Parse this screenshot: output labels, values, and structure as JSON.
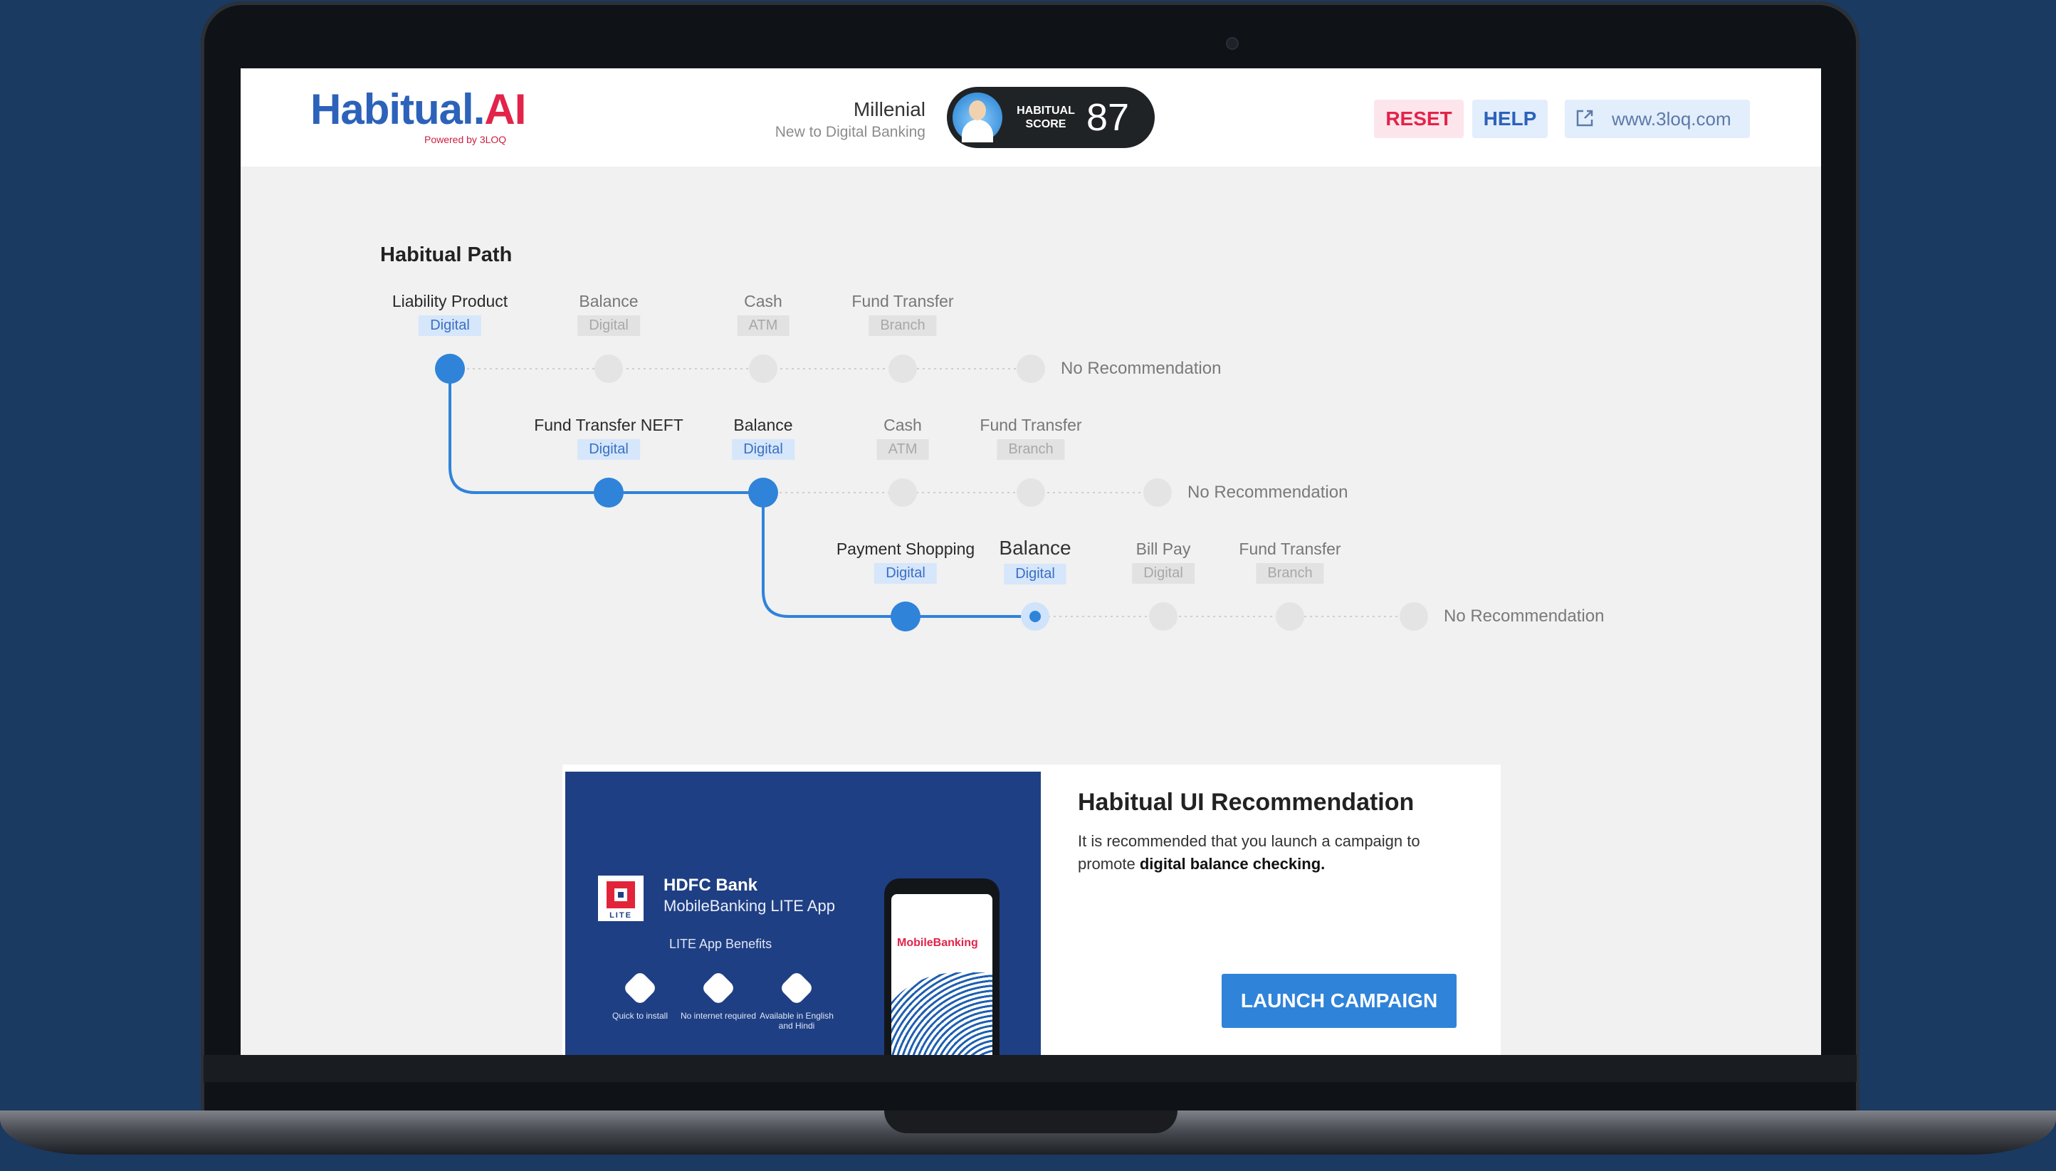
{
  "header": {
    "logo_main": "Habitual.",
    "logo_ai": "AI",
    "logo_powered": "Powered by 3LOQ",
    "persona_name": "Millenial",
    "persona_sub": "New to Digital Banking",
    "score_label_line1": "HABITUAL",
    "score_label_line2": "SCORE",
    "score_value": "87",
    "reset_label": "RESET",
    "help_label": "HELP",
    "site_link": "www.3loq.com"
  },
  "path": {
    "title": "Habitual Path",
    "rows": [
      {
        "steps": [
          {
            "name": "Liability Product",
            "tag": "Digital",
            "active": true
          },
          {
            "name": "Balance",
            "tag": "Digital",
            "active": false
          },
          {
            "name": "Cash",
            "tag": "ATM",
            "active": false
          },
          {
            "name": "Fund Transfer",
            "tag": "Branch",
            "active": false
          }
        ],
        "end_label": "No Recommendation"
      },
      {
        "steps": [
          {
            "name": "Fund Transfer NEFT",
            "tag": "Digital",
            "active": true
          },
          {
            "name": "Balance",
            "tag": "Digital",
            "active": true
          },
          {
            "name": "Cash",
            "tag": "ATM",
            "active": false
          },
          {
            "name": "Fund Transfer",
            "tag": "Branch",
            "active": false
          }
        ],
        "end_label": "No Recommendation"
      },
      {
        "steps": [
          {
            "name": "Payment Shopping",
            "tag": "Digital",
            "active": true
          },
          {
            "name": "Balance",
            "tag": "Digital",
            "active": true
          },
          {
            "name": "Bill Pay",
            "tag": "Digital",
            "active": false
          },
          {
            "name": "Fund Transfer",
            "tag": "Branch",
            "active": false
          }
        ],
        "end_label": "No Recommendation"
      }
    ]
  },
  "recommendation": {
    "title": "Habitual UI Recommendation",
    "text_before": "It is recommended that you launch a campaign to promote ",
    "text_bold": "digital balance checking.",
    "button_label": "LAUNCH CAMPAIGN",
    "ad": {
      "bank_name": "HDFC Bank",
      "app_name": "MobileBanking LITE App",
      "logo_word": "LITE",
      "benefits_label": "LITE App Benefits",
      "benefits": [
        "Quick to install",
        "No internet required",
        "Available in English and Hindi"
      ],
      "phone_title": "MobileBanking"
    }
  },
  "colors": {
    "background": "#1a3a62",
    "brand_blue": "#2c62ba",
    "brand_red": "#e2244a",
    "path_active": "#2f83d9",
    "path_inactive": "#e4e4e4"
  }
}
